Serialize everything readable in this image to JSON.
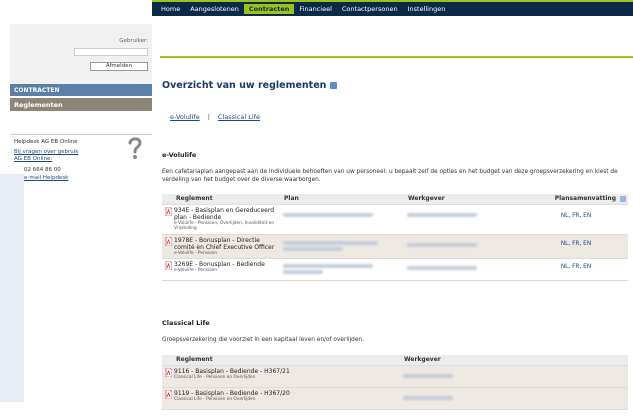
{
  "nav": {
    "items": [
      "Home",
      "Aangeslotenen",
      "Contracten",
      "Financieel",
      "Contactpersonen",
      "Instellingen"
    ],
    "active": "Contracten"
  },
  "sidebar": {
    "login_label": "Gebruiker:",
    "logout_label": "Afmelden",
    "section_contracts": "CONTRACTEN",
    "section_regl": "Reglementen",
    "helpdesk_title": "Helpdesk AG EB Online",
    "helpdesk_link1": "Bij vragen over gebruik AG EB Online:",
    "helpdesk_phone": "02 664 86 00",
    "helpdesk_email": "e-mail Helpdesk"
  },
  "main": {
    "title": "Overzicht van uw reglementen",
    "tabs": [
      "e-Volulife",
      "Classical Life"
    ],
    "tab_sep": "|",
    "evolulife": {
      "heading": "e-Volulife",
      "description": "Een cafetariaplan aangepast aan de individuele behoeften van uw personeel: u bepaalt zelf de opties en het budget van deze groepsverzekering en kiest de verdeling van het budget over de diverse waarborgen.",
      "headers": [
        "Reglement",
        "Plan",
        "Werkgever",
        "Plansamenvatting"
      ],
      "rows": [
        {
          "title": "934E - Basisplan en Gereduceerd plan - Bediende",
          "sub": "e-Volulife - Pensioen, Overlijden, Invaliditeit en Vrijstelling",
          "langs": [
            "NL",
            "FR",
            "EN"
          ]
        },
        {
          "title": "1978E - Bonusplan - Directie comité en Chief Executive Officer",
          "sub": "e-Volulife - Pensioen",
          "langs": [
            "NL",
            "FR",
            "EN"
          ]
        },
        {
          "title": "3269E - Bonusplan - Bediende",
          "sub": "e-Volulife - Pensioen",
          "langs": [
            "NL",
            "FR",
            "EN"
          ]
        }
      ],
      "lang_sep": ","
    },
    "classical": {
      "heading": "Classical Life",
      "description": "Groepsverzekering die voorziet in een kapitaal leven en/of overlijden.",
      "headers": [
        "Reglement",
        "Werkgever"
      ],
      "rows": [
        {
          "title": "9116 - Basisplan - Bediende - H367/21",
          "sub": "Classical Life - Pensioen en Overlijden"
        },
        {
          "title": "9119 - Basisplan - Bediende - H367/20",
          "sub": "Classical Life - Pensioen en Overlijden"
        }
      ]
    }
  },
  "colors": {
    "navy": "#0b2a4a",
    "green_accent": "#9bc31c",
    "link_blue": "#1a4b80",
    "row_alt": "#eee8e3"
  },
  "icons": [
    "question-mark-icon",
    "help-icon",
    "pdf-icon"
  ]
}
